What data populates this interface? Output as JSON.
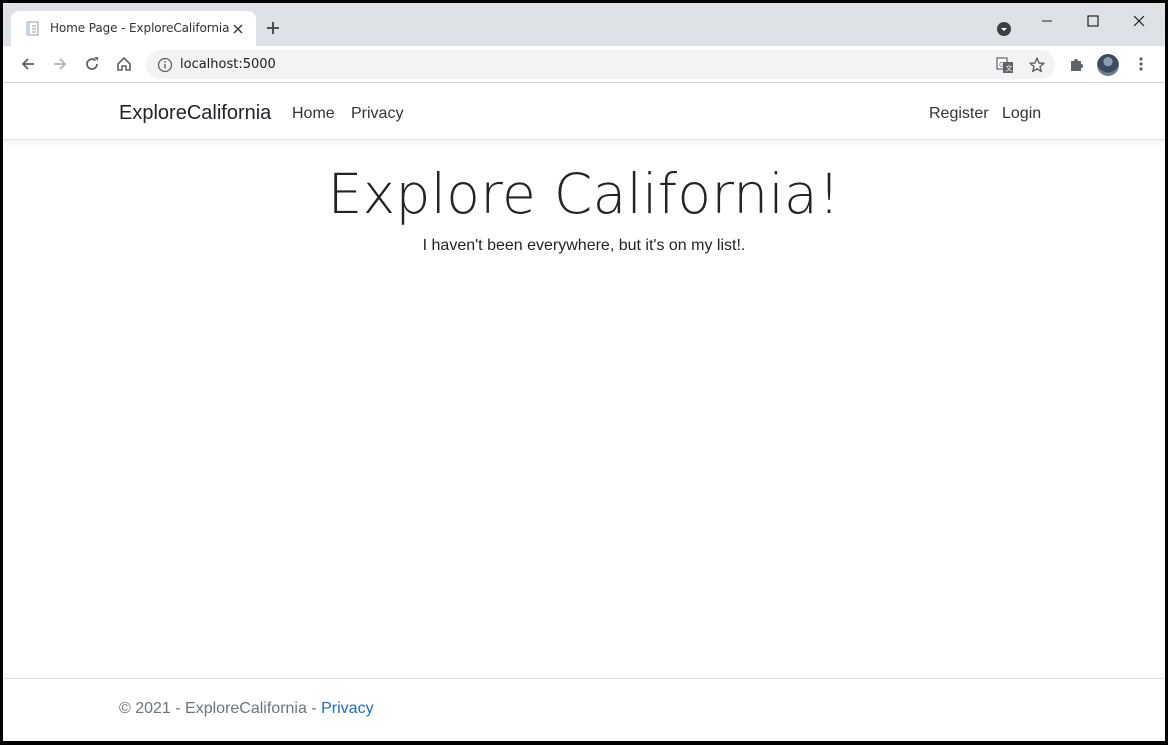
{
  "browser": {
    "tab_title": "Home Page - ExploreCalifornia",
    "url": "localhost:5000"
  },
  "navbar": {
    "brand": "ExploreCalifornia",
    "links": [
      "Home",
      "Privacy"
    ],
    "right_links": [
      "Register",
      "Login"
    ]
  },
  "hero": {
    "title": "Explore California!",
    "subtitle": "I haven't been everywhere, but it's on my list!."
  },
  "footer": {
    "text": "© 2021 - ExploreCalifornia - ",
    "link": "Privacy",
    "link_color": "#1b6ec2"
  },
  "icons": {
    "tab": [
      "page-favicon-icon",
      "close-icon",
      "plus-icon",
      "tab-search-icon"
    ],
    "window": [
      "minimize-icon",
      "maximize-icon",
      "close-window-icon"
    ],
    "toolbar": [
      "back-arrow-icon",
      "forward-arrow-icon",
      "reload-icon",
      "home-icon",
      "info-icon",
      "translate-icon",
      "star-icon",
      "extensions-puzzle-icon",
      "avatar",
      "kebab-menu-icon"
    ]
  }
}
